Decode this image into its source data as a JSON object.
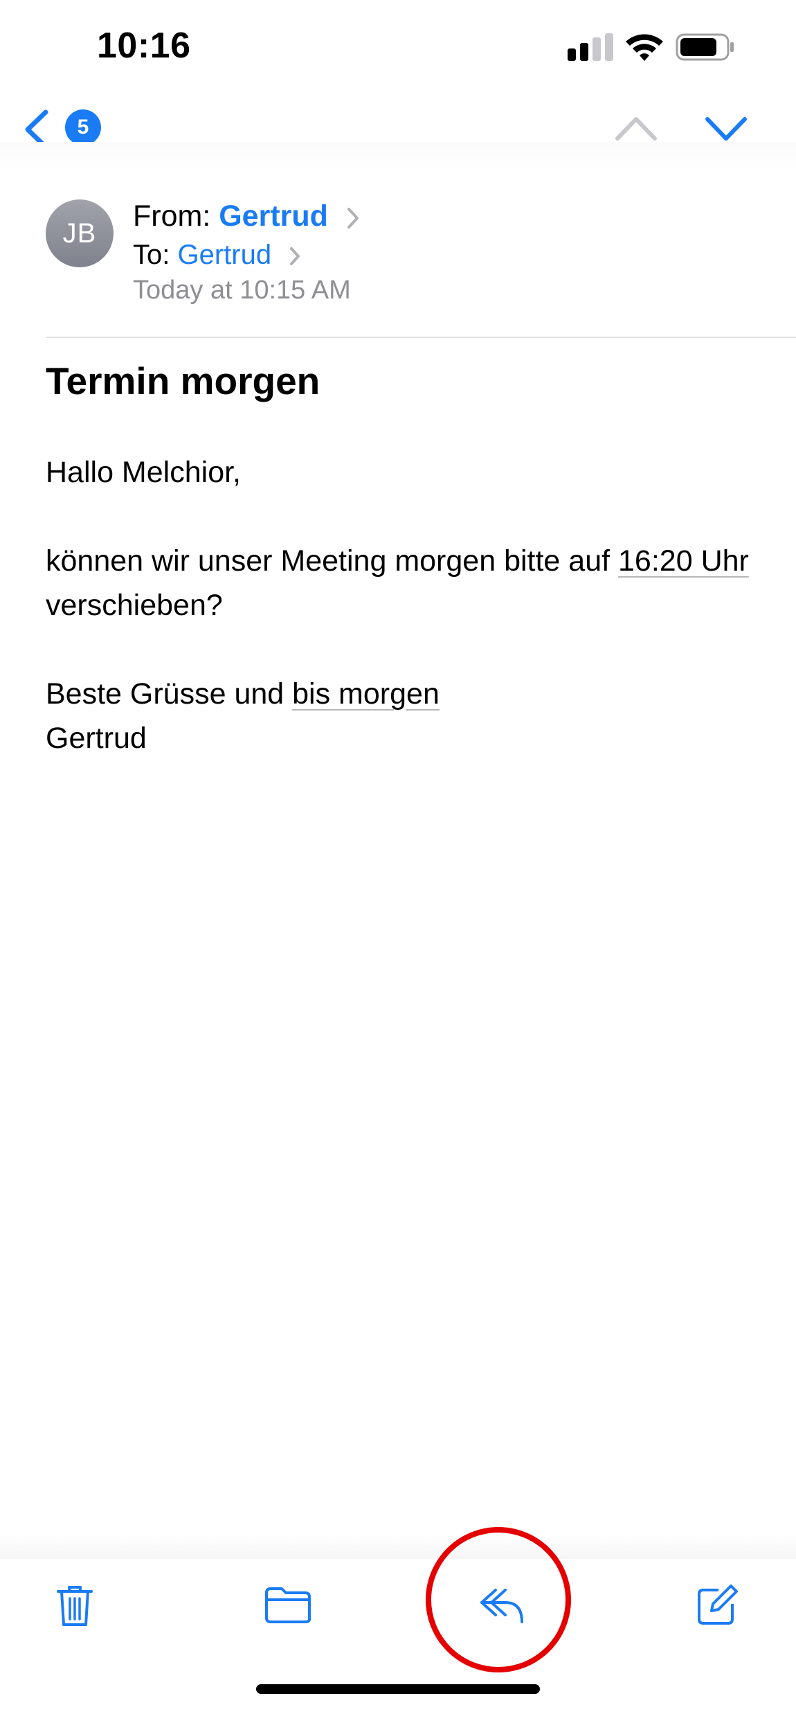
{
  "status_bar": {
    "time": "10:16"
  },
  "nav": {
    "unread_badge": "5"
  },
  "message": {
    "avatar_initials": "JB",
    "from_label": "From:",
    "from_name": "Gertrud",
    "to_label": "To:",
    "to_name": "Gertrud",
    "date": "Today at 10:15 AM",
    "subject": "Termin morgen",
    "greeting": "Hallo Melchior,",
    "line1_prefix": "können wir unser Meeting morgen bitte auf ",
    "line1_link": "16:20 Uhr",
    "line1_suffix": " verschieben?",
    "closing_prefix": "Beste Grüsse und ",
    "closing_link": "bis morgen",
    "signature": "Gertrud"
  },
  "colors": {
    "accent": "#1a7cf5",
    "highlight": "#e50000",
    "secondary_text": "#8e8e93"
  },
  "icons": [
    "back-chevron-icon",
    "up-chevron-icon",
    "down-chevron-icon",
    "trash-icon",
    "folder-icon",
    "reply-icon",
    "compose-icon"
  ]
}
